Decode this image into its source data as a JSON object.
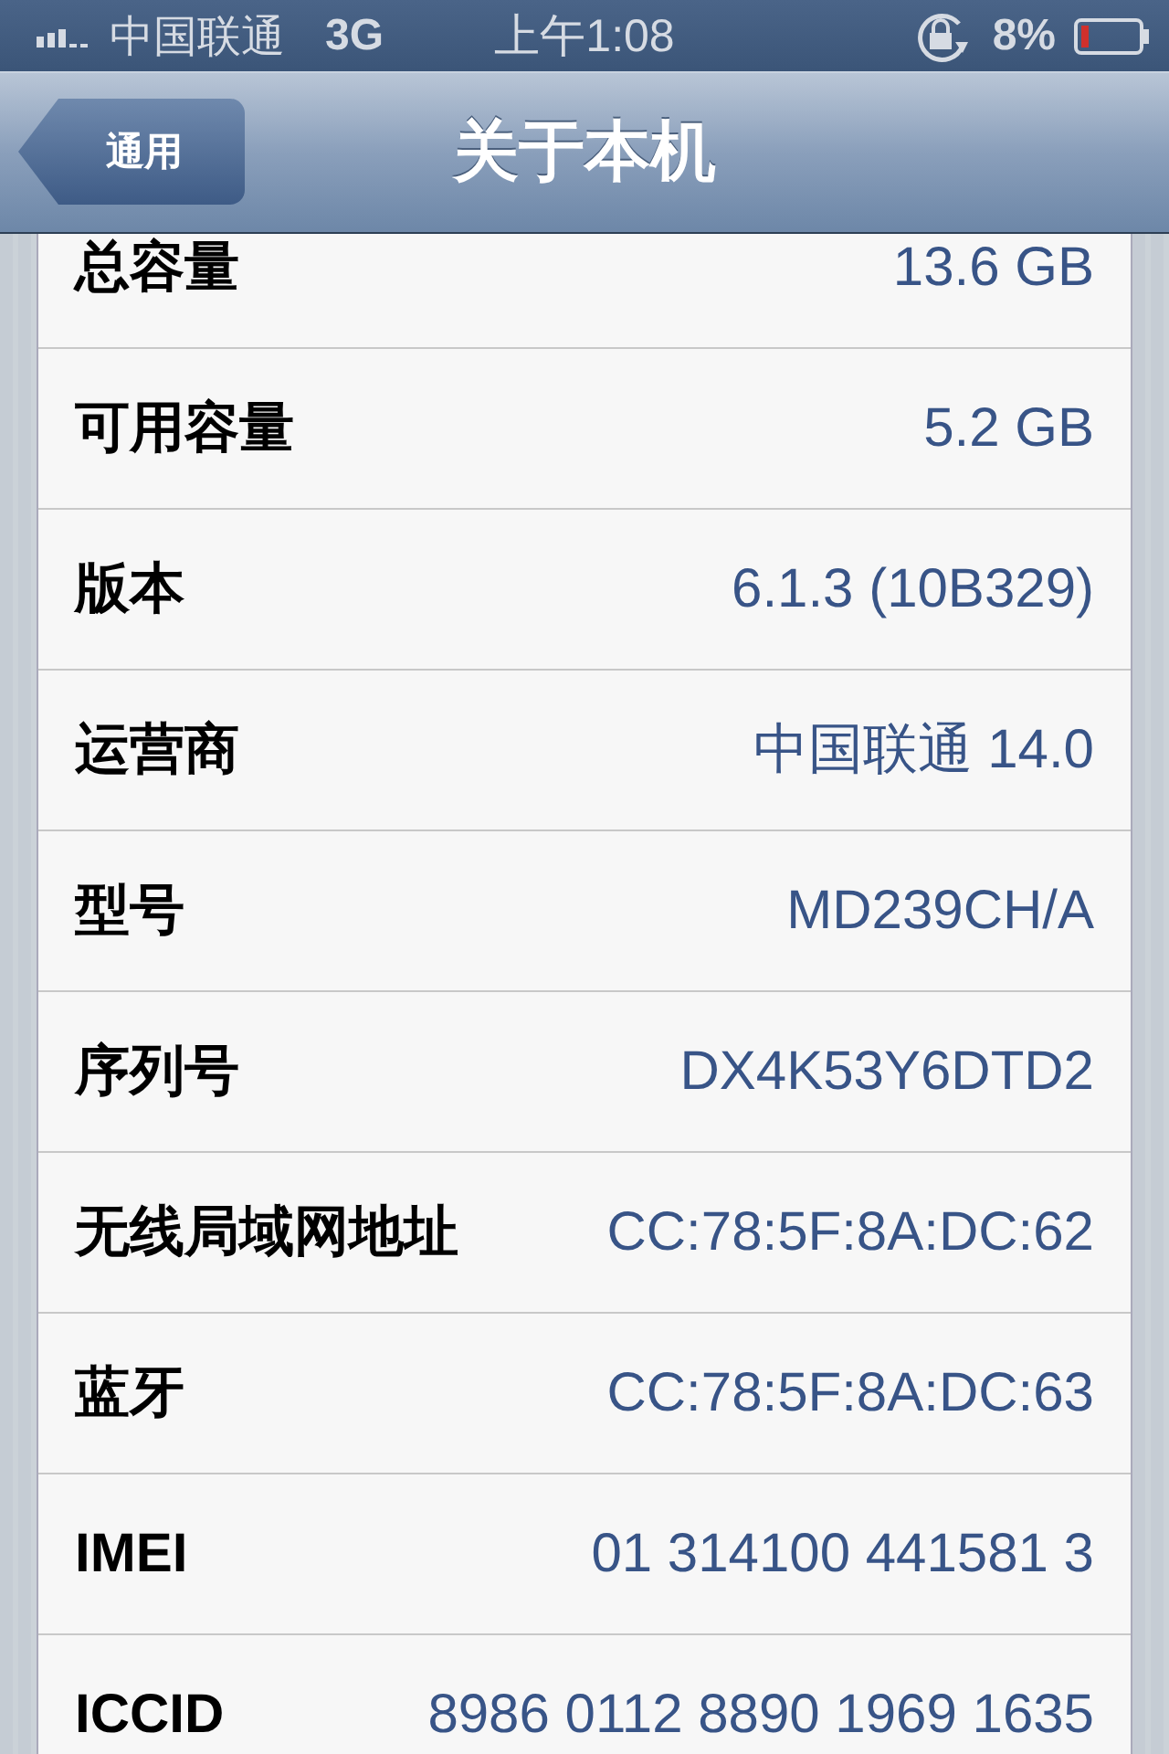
{
  "status_bar": {
    "carrier": "中国联通",
    "network": "3G",
    "time": "上午1:08",
    "battery": "8%"
  },
  "nav_bar": {
    "back": "通用",
    "title": "关于本机"
  },
  "rows": [
    {
      "label": "总容量",
      "value": "13.6 GB"
    },
    {
      "label": "可用容量",
      "value": "5.2 GB"
    },
    {
      "label": "版本",
      "value": "6.1.3 (10B329)"
    },
    {
      "label": "运营商",
      "value": "中国联通 14.0"
    },
    {
      "label": "型号",
      "value": "MD239CH/A"
    },
    {
      "label": "序列号",
      "value": "DX4K53Y6DTD2"
    },
    {
      "label": "无线局域网地址",
      "value": "CC:78:5F:8A:DC:62"
    },
    {
      "label": "蓝牙",
      "value": "CC:78:5F:8A:DC:63"
    },
    {
      "label": "IMEI",
      "value": "01 314100 441581 3"
    },
    {
      "label": "ICCID",
      "value": "8986 0112 8890 1969 1635"
    }
  ]
}
